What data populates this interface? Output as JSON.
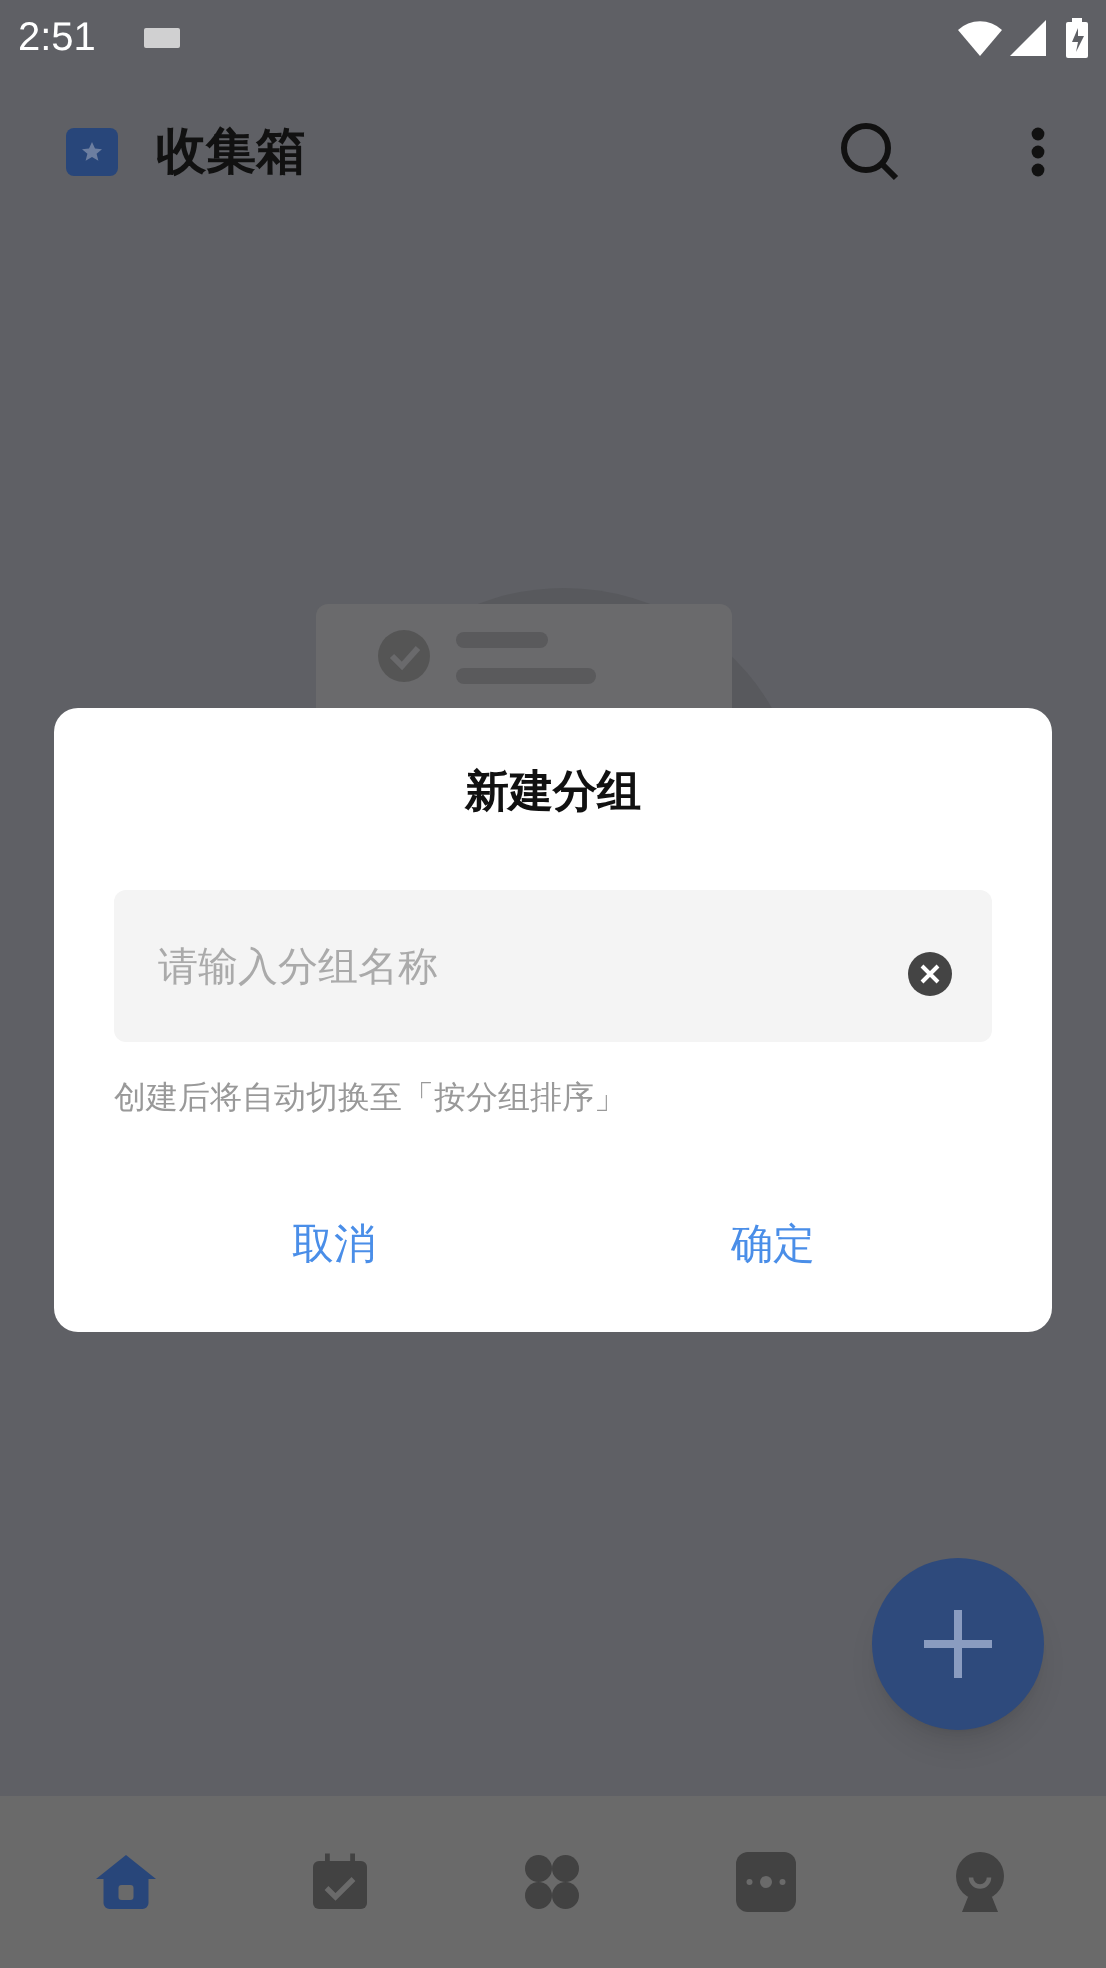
{
  "status_bar": {
    "time": "2:51"
  },
  "app_bar": {
    "title": "收集箱"
  },
  "dialog": {
    "title": "新建分组",
    "input": {
      "placeholder": "请输入分组名称"
    },
    "hint": "创建后将自动切换至「按分组排序」",
    "buttons": [
      {
        "label": "取消"
      },
      {
        "label": "确定"
      }
    ]
  },
  "bottom_nav": [
    {
      "kind": "home",
      "selected": true
    },
    {
      "kind": "calendar",
      "selected": false
    },
    {
      "kind": "apps",
      "selected": false
    },
    {
      "kind": "more",
      "selected": false
    },
    {
      "kind": "profile",
      "selected": false
    }
  ]
}
